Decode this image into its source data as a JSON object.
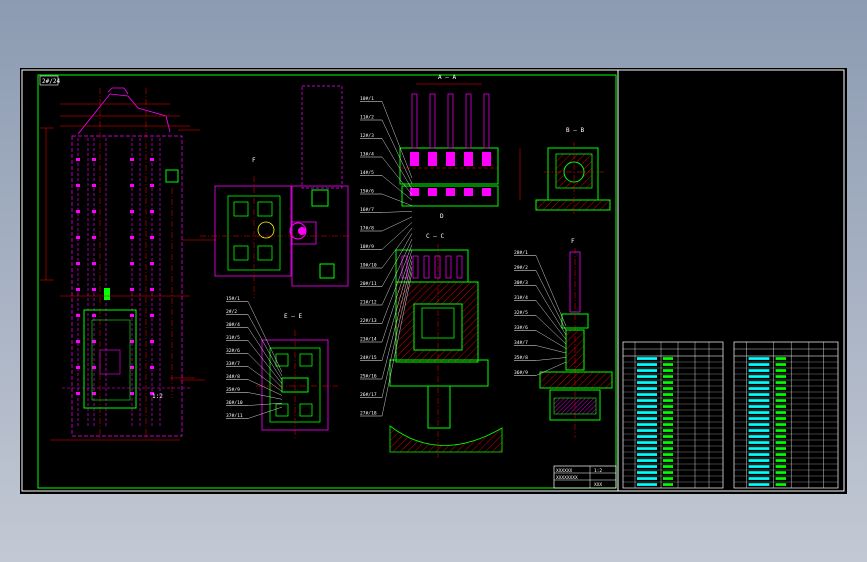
{
  "drawing": {
    "corner_tag": "2#/24",
    "view_labels": {
      "section_a": "A — A",
      "section_b": "B — B",
      "section_c": "C — C",
      "section_e": "E — E",
      "view_f": "F",
      "view_d": "D"
    },
    "left_callouts": [
      "15#/1",
      "2#/2",
      "30#/4",
      "31#/5",
      "32#/6",
      "33#/7",
      "34#/8",
      "35#/9",
      "36#/10",
      "37#/11"
    ],
    "mid_callouts": [
      "10#/1",
      "11#/2",
      "12#/3",
      "13#/4",
      "14#/5",
      "15#/6",
      "16#/7",
      "17#/8",
      "18#/9",
      "19#/10",
      "20#/11",
      "21#/12",
      "22#/13",
      "23#/14",
      "24#/15",
      "25#/16",
      "26#/17",
      "27#/18"
    ],
    "right_callouts": [
      "28#/1",
      "29#/2",
      "30#/3",
      "31#/4",
      "32#/5",
      "33#/6",
      "34#/7",
      "35#/8",
      "36#/9"
    ],
    "title_block": {
      "line1": "XXXXXX",
      "line2": "XXXXXXXX",
      "scale": "1:2",
      "sheet": "XXX"
    }
  },
  "bom_tables": [
    {
      "rows": 22
    },
    {
      "rows": 22
    }
  ],
  "colors": {
    "background": "#000000",
    "border": "#ffffff",
    "inner_border": "#00ff00",
    "part": "#00ff00",
    "hidden": "#ff00ff",
    "centerline": "#ff0000",
    "dimension": "#ff0000",
    "annotation": "#ffffff",
    "table_text": "#00ffff",
    "hatch": "#ff0000"
  }
}
